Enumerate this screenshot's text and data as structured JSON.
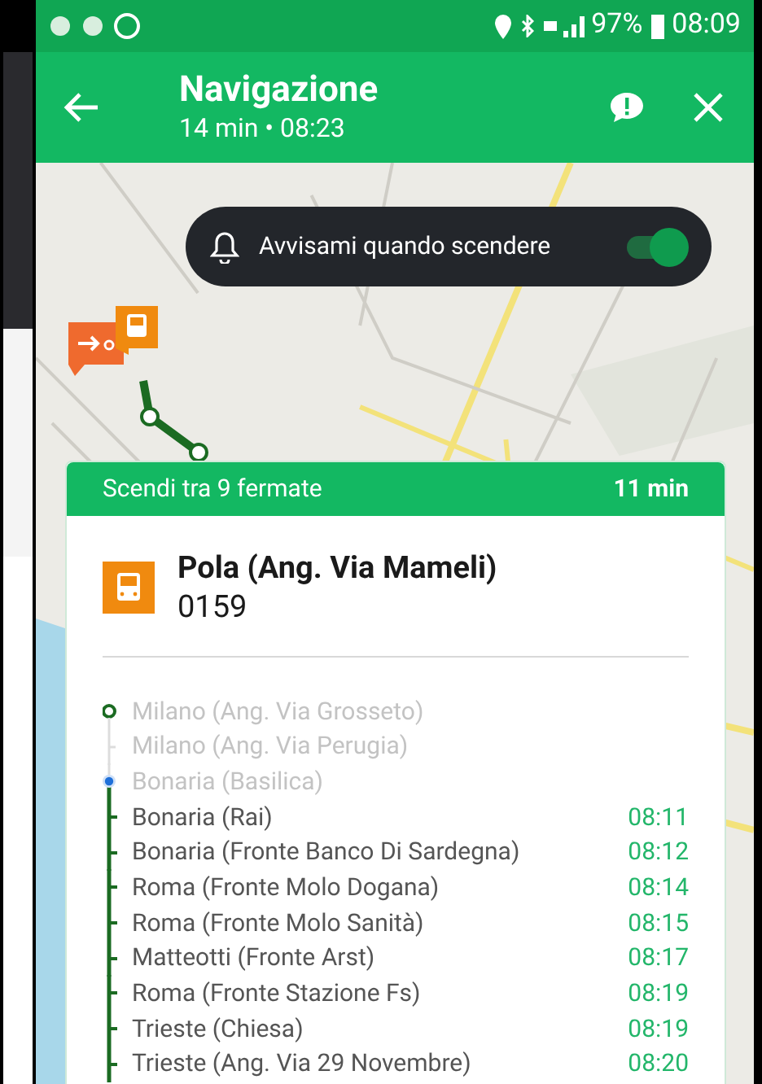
{
  "status_bar": {
    "battery": "97%",
    "time": "08:09"
  },
  "header": {
    "title": "Navigazione",
    "subtitle": "14 min • 08:23"
  },
  "alert": {
    "label": "Avvisami quando scendere",
    "on": true
  },
  "card": {
    "title": "Scendi tra 9 fermate",
    "duration": "11 min",
    "stop_name": "Pola (Ang. Via Mameli)",
    "stop_code": "0159",
    "stops": [
      {
        "name": "Milano (Ang. Via Grosseto)",
        "kind": "origin"
      },
      {
        "name": "Milano (Ang. Via Perugia)",
        "kind": "passed"
      },
      {
        "name": "Bonaria (Basilica)",
        "kind": "current"
      },
      {
        "name": "Bonaria (Rai)",
        "kind": "upcoming",
        "time": "08:11"
      },
      {
        "name": "Bonaria (Fronte Banco Di Sardegna)",
        "kind": "upcoming",
        "time": "08:12"
      },
      {
        "name": "Roma (Fronte Molo Dogana)",
        "kind": "upcoming",
        "time": "08:14"
      },
      {
        "name": "Roma (Fronte Molo Sanità)",
        "kind": "upcoming",
        "time": "08:15"
      },
      {
        "name": "Matteotti (Fronte Arst)",
        "kind": "upcoming",
        "time": "08:17"
      },
      {
        "name": "Roma (Fronte Stazione Fs)",
        "kind": "upcoming",
        "time": "08:19"
      },
      {
        "name": "Trieste (Chiesa)",
        "kind": "upcoming",
        "time": "08:19"
      },
      {
        "name": "Trieste (Ang. Via 29 Novembre)",
        "kind": "upcoming",
        "time": "08:20"
      }
    ]
  }
}
